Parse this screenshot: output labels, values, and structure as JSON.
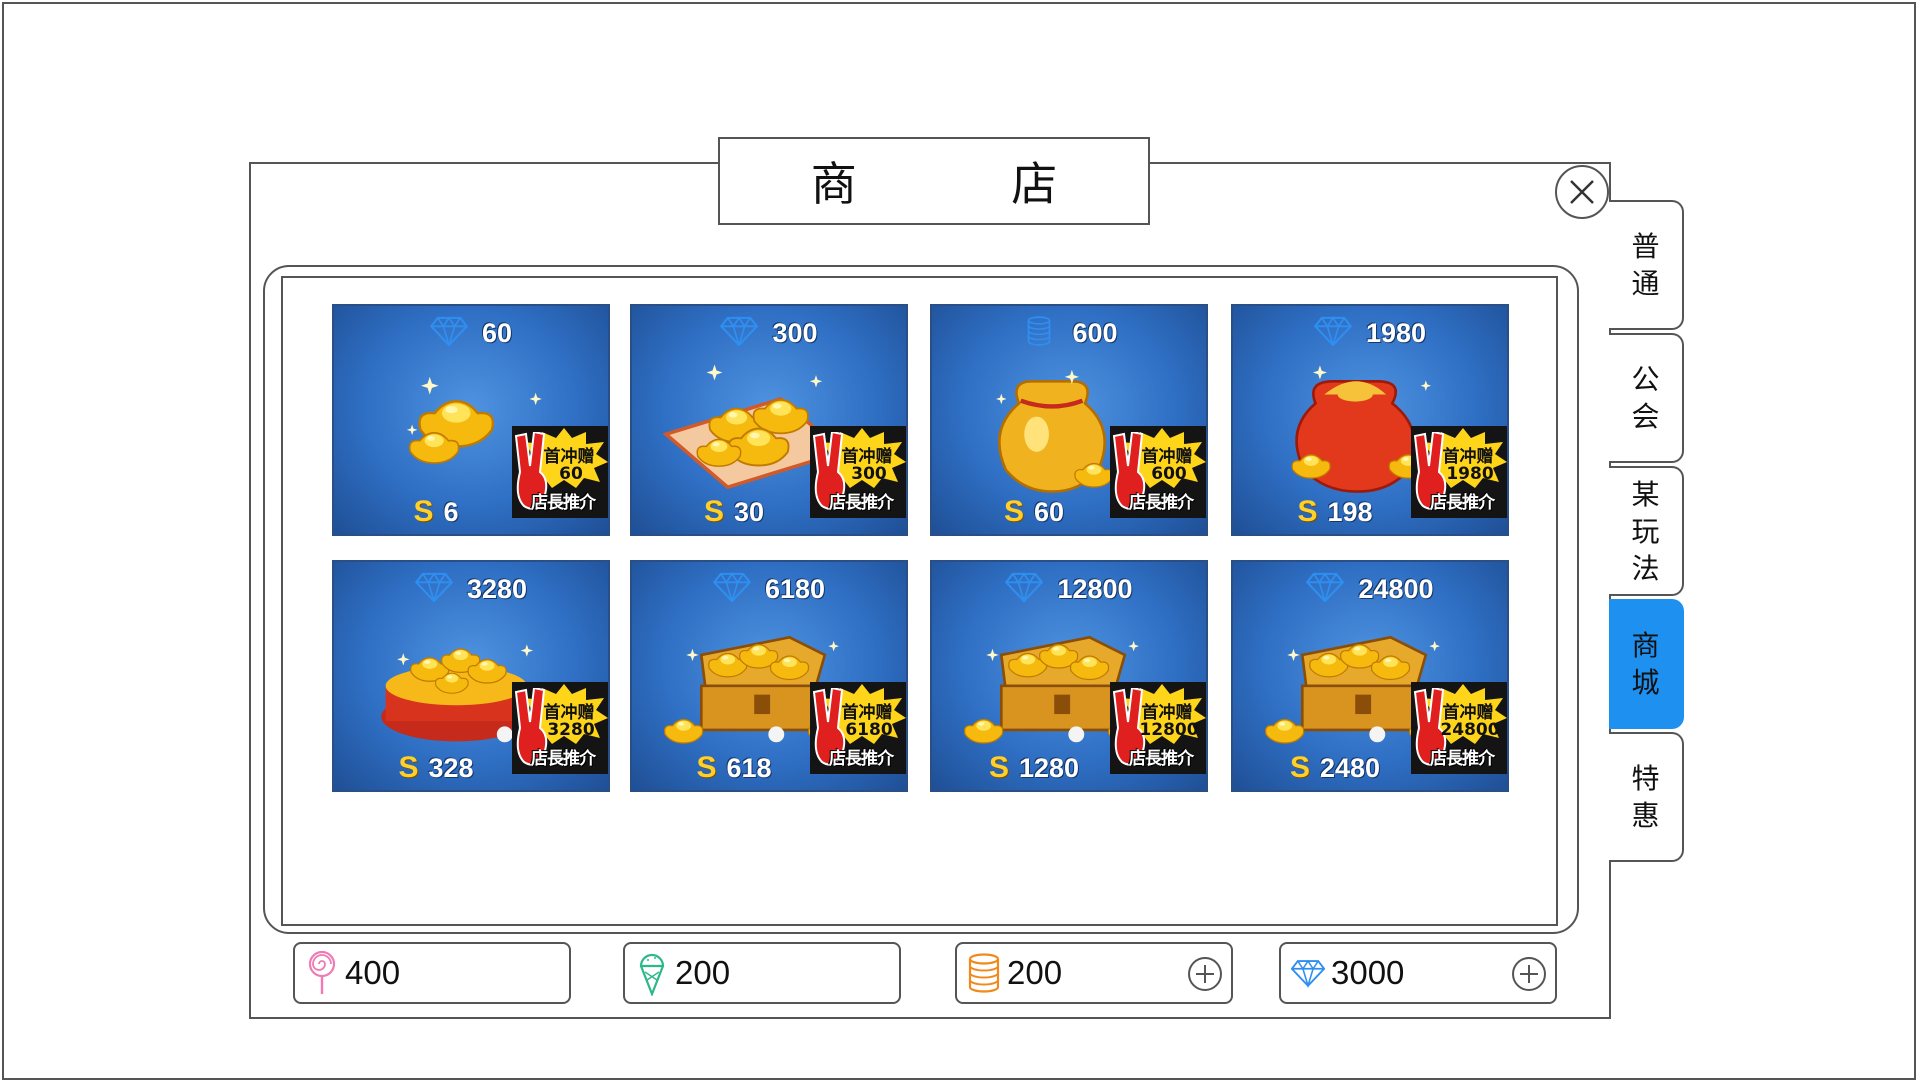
{
  "title": "商  店",
  "side_tabs": [
    {
      "label": [
        "普",
        "通"
      ],
      "active": false
    },
    {
      "label": [
        "公",
        "会"
      ],
      "active": false
    },
    {
      "label": [
        "某",
        "玩",
        "法"
      ],
      "active": false
    },
    {
      "label": [
        "商",
        "城"
      ],
      "active": true
    },
    {
      "label": [
        "特",
        "惠"
      ],
      "active": false
    }
  ],
  "shop_items": [
    {
      "amount": "60",
      "icon": "diamond-icon",
      "price": "6",
      "promo_amount": "60",
      "art": "ingots-small"
    },
    {
      "amount": "300",
      "icon": "diamond-icon",
      "price": "30",
      "promo_amount": "300",
      "art": "ingots-carpet"
    },
    {
      "amount": "600",
      "icon": "coin-stack-icon",
      "price": "60",
      "promo_amount": "600",
      "art": "gold-bag"
    },
    {
      "amount": "1980",
      "icon": "diamond-icon",
      "price": "198",
      "promo_amount": "1980",
      "art": "red-bag"
    },
    {
      "amount": "3280",
      "icon": "diamond-icon",
      "price": "328",
      "promo_amount": "3280",
      "art": "treasure-pot"
    },
    {
      "amount": "6180",
      "icon": "diamond-icon",
      "price": "618",
      "promo_amount": "6180",
      "art": "treasure-chest"
    },
    {
      "amount": "12800",
      "icon": "diamond-icon",
      "price": "1280",
      "promo_amount": "12800",
      "art": "treasure-chest"
    },
    {
      "amount": "24800",
      "icon": "diamond-icon",
      "price": "2480",
      "promo_amount": "24800",
      "art": "treasure-chest"
    }
  ],
  "promo": {
    "line1": "首冲赠",
    "line3": "店長推介"
  },
  "currency_symbol": "S",
  "currencies": [
    {
      "icon": "lollipop-icon",
      "value": "400",
      "addable": false,
      "color": "#f07ab5"
    },
    {
      "icon": "ice-cream-icon",
      "value": "200",
      "addable": false,
      "color": "#2db888"
    },
    {
      "icon": "coin-stack-icon",
      "value": "200",
      "addable": true,
      "color": "#f08a1c"
    },
    {
      "icon": "diamond-icon",
      "value": "3000",
      "addable": true,
      "color": "#2f8ff0"
    }
  ],
  "colors": {
    "accent": "#1e90f0",
    "card_blue": "#2f6fc4",
    "gold": "#ffcf2a"
  }
}
